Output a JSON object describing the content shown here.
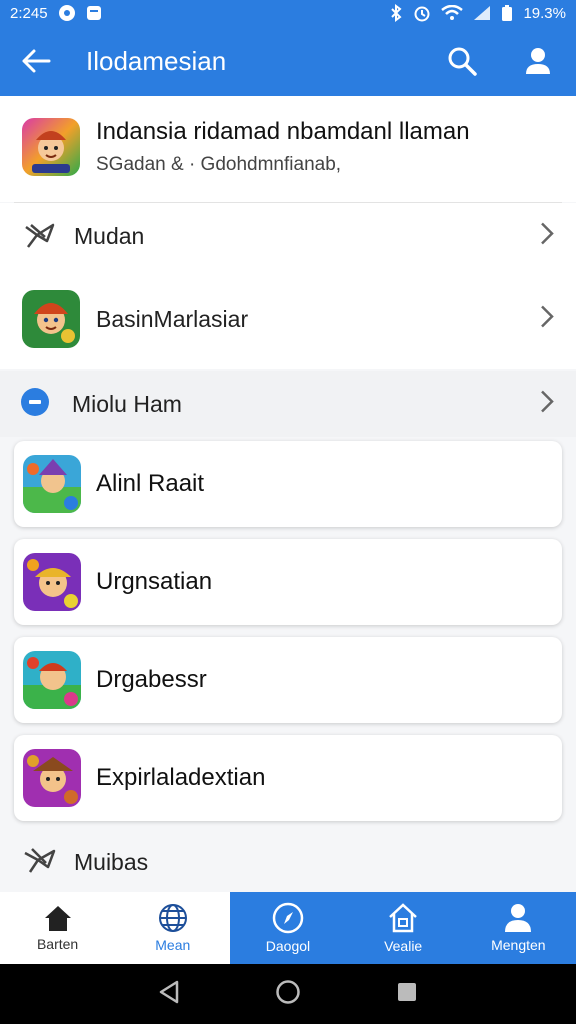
{
  "status_bar": {
    "time": "2:245",
    "battery": "19.3%"
  },
  "app_bar": {
    "title": "Ilodamesian"
  },
  "header": {
    "app_name": "Indansia ridamad nbamdanl llaman",
    "subtitle": "SGadan & · Gdohdmnfianab,"
  },
  "rows": [
    {
      "label": "Mudan",
      "icon": "plane-icon"
    },
    {
      "label": "BasinMarlasiar",
      "icon": "game-icon"
    },
    {
      "label": "Miolu Ham",
      "icon": "minus-circle-icon"
    }
  ],
  "cards": [
    {
      "label": "Alinl Raait"
    },
    {
      "label": "Urgnsatian"
    },
    {
      "label": "Drgabessr"
    },
    {
      "label": "Expirlaladextian"
    }
  ],
  "footer_section": {
    "label": "Muibas"
  },
  "bottom_nav": [
    {
      "label": "Barten",
      "icon": "home-icon"
    },
    {
      "label": "Mean",
      "icon": "globe-icon"
    },
    {
      "label": "Daogol",
      "icon": "compass-icon"
    },
    {
      "label": "Vealie",
      "icon": "house-icon"
    },
    {
      "label": "Mengten",
      "icon": "person-icon"
    }
  ],
  "colors": {
    "primary": "#2b7de0",
    "background": "#f5f6f8"
  }
}
